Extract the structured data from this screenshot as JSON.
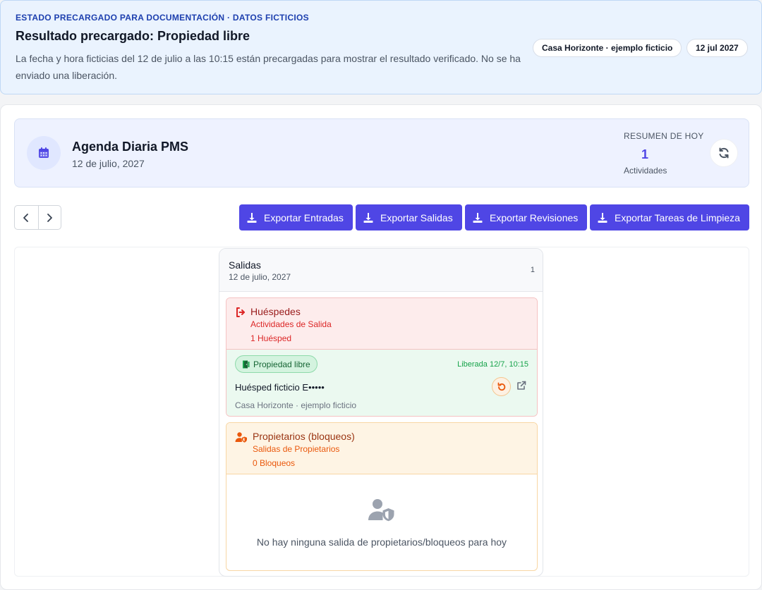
{
  "banner": {
    "kicker": "ESTADO PRECARGADO PARA DOCUMENTACIÓN · DATOS FICTICIOS",
    "title": "Resultado precargado: Propiedad libre",
    "description": "La fecha y hora ficticias del 12 de julio a las 10:15 están precargadas para mostrar el resultado verificado. No se ha enviado una liberación.",
    "property_pill": "Casa Horizonte · ejemplo ficticio",
    "date_pill": "12 jul 2027"
  },
  "agenda": {
    "title": "Agenda Diaria PMS",
    "date": "12 de julio, 2027",
    "summary_label": "RESUMEN DE HOY",
    "summary_count": "1",
    "summary_sub": "Actividades"
  },
  "toolbar": {
    "exports": [
      {
        "label": "Exportar Entradas"
      },
      {
        "label": "Exportar Salidas"
      },
      {
        "label": "Exportar Revisiones"
      },
      {
        "label": "Exportar Tareas de Limpieza"
      }
    ]
  },
  "column": {
    "title": "Salidas",
    "date": "12 de julio, 2027",
    "count": "1",
    "guests": {
      "title": "Huéspedes",
      "subtitle": "Actividades de Salida",
      "count": "1 Huésped",
      "card": {
        "badge": "Propiedad libre",
        "released": "Liberada 12/7, 10:15",
        "name": "Huésped ficticio E•••••",
        "property": "Casa Horizonte · ejemplo ficticio"
      }
    },
    "owners": {
      "title": "Propietarios (bloqueos)",
      "subtitle": "Salidas de Propietarios",
      "count": "0 Bloqueos",
      "empty": "No hay ninguna salida de propietarios/bloqueos para hoy"
    }
  },
  "colors": {
    "accent": "#4f46e5",
    "guests_red": "#dc2626",
    "owners_orange": "#ea580c",
    "free_green": "#16a34a"
  },
  "icons": {
    "agenda": "calendar-icon",
    "refresh": "refresh-icon",
    "prev": "chevron-left-icon",
    "next": "chevron-right-icon",
    "export": "download-icon",
    "guests": "sign-out-icon",
    "free": "door-open-icon",
    "undo": "undo-icon",
    "open": "external-link-icon",
    "owners": "user-shield-icon"
  }
}
